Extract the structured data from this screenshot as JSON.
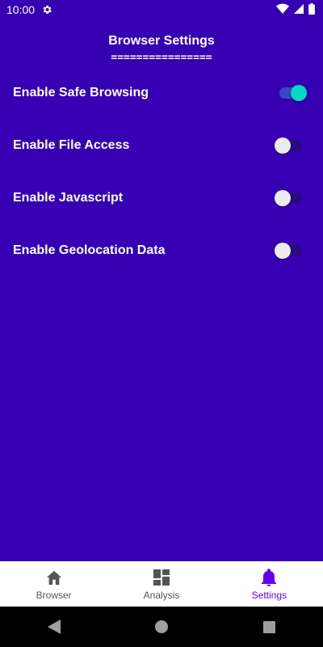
{
  "status_bar": {
    "time": "10:00"
  },
  "page": {
    "title": "Browser Settings",
    "underline": "================"
  },
  "settings": [
    {
      "label": "Enable Safe Browsing",
      "enabled": true
    },
    {
      "label": "Enable File Access",
      "enabled": false
    },
    {
      "label": "Enable Javascript",
      "enabled": false
    },
    {
      "label": "Enable Geolocation Data",
      "enabled": false
    }
  ],
  "bottom_nav": {
    "items": [
      {
        "label": "Browser",
        "icon": "home-icon"
      },
      {
        "label": "Analysis",
        "icon": "dashboard-icon"
      },
      {
        "label": "Settings",
        "icon": "bell-icon",
        "active": true
      }
    ]
  },
  "colors": {
    "background": "#3700B3",
    "switch_on_thumb": "#03DAC5",
    "nav_active": "#6200EE"
  }
}
